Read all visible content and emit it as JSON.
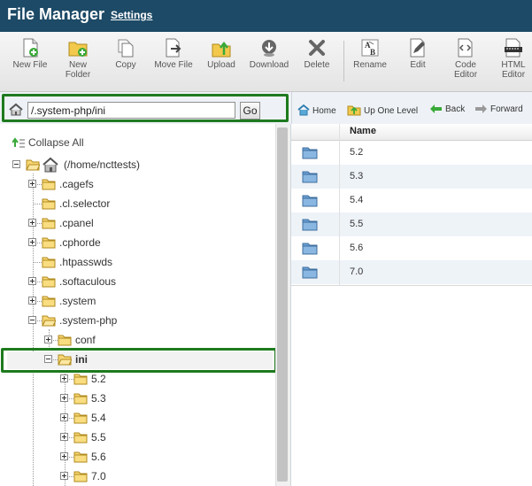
{
  "header": {
    "title": "File Manager",
    "settings_label": "Settings"
  },
  "toolbar": {
    "items": [
      {
        "label": "New File",
        "icon": "new-file-icon"
      },
      {
        "label": "New\nFolder",
        "icon": "new-folder-icon"
      },
      {
        "label": "Copy",
        "icon": "copy-icon"
      },
      {
        "label": "Move File",
        "icon": "move-file-icon"
      },
      {
        "label": "Upload",
        "icon": "upload-icon"
      },
      {
        "label": "Download",
        "icon": "download-icon"
      },
      {
        "label": "Delete",
        "icon": "delete-icon"
      },
      {
        "label": "Rename",
        "icon": "rename-icon"
      },
      {
        "label": "Edit",
        "icon": "edit-icon"
      },
      {
        "label": "Code\nEditor",
        "icon": "code-editor-icon"
      },
      {
        "label": "HTML\nEditor",
        "icon": "html-editor-icon"
      }
    ]
  },
  "pathbar": {
    "value": "/.system-php/ini",
    "go_label": "Go"
  },
  "nav": {
    "home": "Home",
    "up": "Up One Level",
    "back": "Back",
    "forward": "Forward"
  },
  "tree": {
    "collapse_all": "Collapse All",
    "root": "(/home/ncttests)",
    "items": [
      {
        "label": ".cagefs",
        "level": 1,
        "expander": "plus"
      },
      {
        "label": ".cl.selector",
        "level": 1,
        "expander": "none"
      },
      {
        "label": ".cpanel",
        "level": 1,
        "expander": "plus"
      },
      {
        "label": ".cphorde",
        "level": 1,
        "expander": "plus"
      },
      {
        "label": ".htpasswds",
        "level": 1,
        "expander": "none"
      },
      {
        "label": ".softaculous",
        "level": 1,
        "expander": "plus"
      },
      {
        "label": ".system",
        "level": 1,
        "expander": "plus"
      },
      {
        "label": ".system-php",
        "level": 1,
        "expander": "minus"
      },
      {
        "label": "conf",
        "level": 2,
        "expander": "plus"
      },
      {
        "label": "ini",
        "level": 2,
        "expander": "minus"
      },
      {
        "label": "5.2",
        "level": 3,
        "expander": "plus"
      },
      {
        "label": "5.3",
        "level": 3,
        "expander": "plus"
      },
      {
        "label": "5.4",
        "level": 3,
        "expander": "plus"
      },
      {
        "label": "5.5",
        "level": 3,
        "expander": "plus"
      },
      {
        "label": "5.6",
        "level": 3,
        "expander": "plus"
      },
      {
        "label": "7.0",
        "level": 3,
        "expander": "plus"
      }
    ]
  },
  "filelist": {
    "column_name": "Name",
    "rows": [
      "5.2",
      "5.3",
      "5.4",
      "5.5",
      "5.6",
      "7.0"
    ]
  }
}
